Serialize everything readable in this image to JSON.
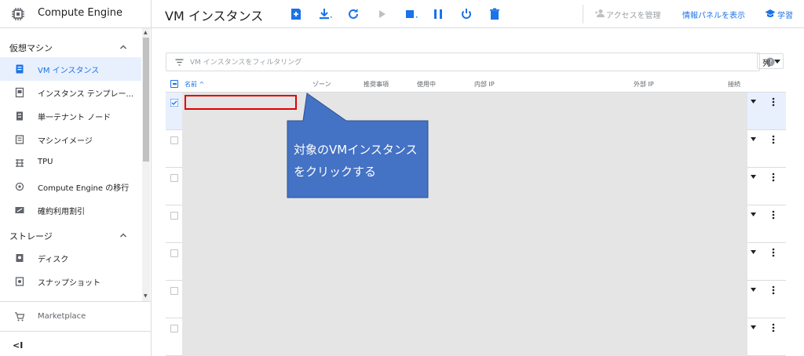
{
  "app": {
    "product_name": "Compute Engine",
    "page_title": "VM インスタンス"
  },
  "toolbar": {
    "buttons": [
      {
        "name": "create-instance-button",
        "icon": "add-box-icon"
      },
      {
        "name": "import-vm-button",
        "icon": "download-icon"
      },
      {
        "name": "refresh-button",
        "icon": "refresh-icon"
      },
      {
        "name": "start-button",
        "icon": "play-icon"
      },
      {
        "name": "stop-button",
        "icon": "stop-icon"
      },
      {
        "name": "pause-button",
        "icon": "pause-icon"
      },
      {
        "name": "reset-button",
        "icon": "power-icon"
      },
      {
        "name": "delete-button",
        "icon": "trash-icon"
      }
    ],
    "manage_access_label": "アクセスを管理",
    "info_panel_label": "情報パネルを表示",
    "learn_label": "学習"
  },
  "sidebar": {
    "section_vm": "仮想マシン",
    "vm_items": [
      {
        "label": "VM インスタンス",
        "icon": "vm-instance-icon",
        "selected": true
      },
      {
        "label": "インスタンス テンプレー...",
        "icon": "template-icon",
        "selected": false
      },
      {
        "label": "単一テナント ノード",
        "icon": "sole-tenant-icon",
        "selected": false
      },
      {
        "label": "マシンイメージ",
        "icon": "machine-image-icon",
        "selected": false
      },
      {
        "label": "TPU",
        "icon": "tpu-icon",
        "selected": false
      },
      {
        "label": "Compute Engine の移行",
        "icon": "migrate-icon",
        "selected": false
      },
      {
        "label": "確約利用割引",
        "icon": "percent-icon",
        "selected": false
      }
    ],
    "section_storage": "ストレージ",
    "storage_items": [
      {
        "label": "ディスク",
        "icon": "disk-icon"
      },
      {
        "label": "スナップショット",
        "icon": "snapshot-icon"
      }
    ],
    "marketplace_label": "Marketplace",
    "collapse_glyph": "<I"
  },
  "filter": {
    "placeholder": "VM インスタンスをフィルタリング"
  },
  "columns_button_label": "列",
  "table": {
    "headers": {
      "name": "名前 ^",
      "zone": "ゾーン",
      "recommendation": "推奨事項",
      "in_use_by": "使用中",
      "internal_ip": "内部 IP",
      "external_ip": "外部 IP",
      "connect": "接続"
    },
    "rows": [
      {
        "selected": true
      },
      {
        "selected": false
      },
      {
        "selected": false
      },
      {
        "selected": false
      },
      {
        "selected": false
      },
      {
        "selected": false
      },
      {
        "selected": false
      }
    ]
  },
  "annotation": {
    "callout_text": "対象のVMインスタンスをクリックする",
    "callout_color": "#4472c4",
    "highlight_color": "#e00000"
  },
  "colors": {
    "accent": "#1a73e8",
    "selected_bg": "#e8f0fe",
    "redaction_gray": "#e5e5e5"
  }
}
